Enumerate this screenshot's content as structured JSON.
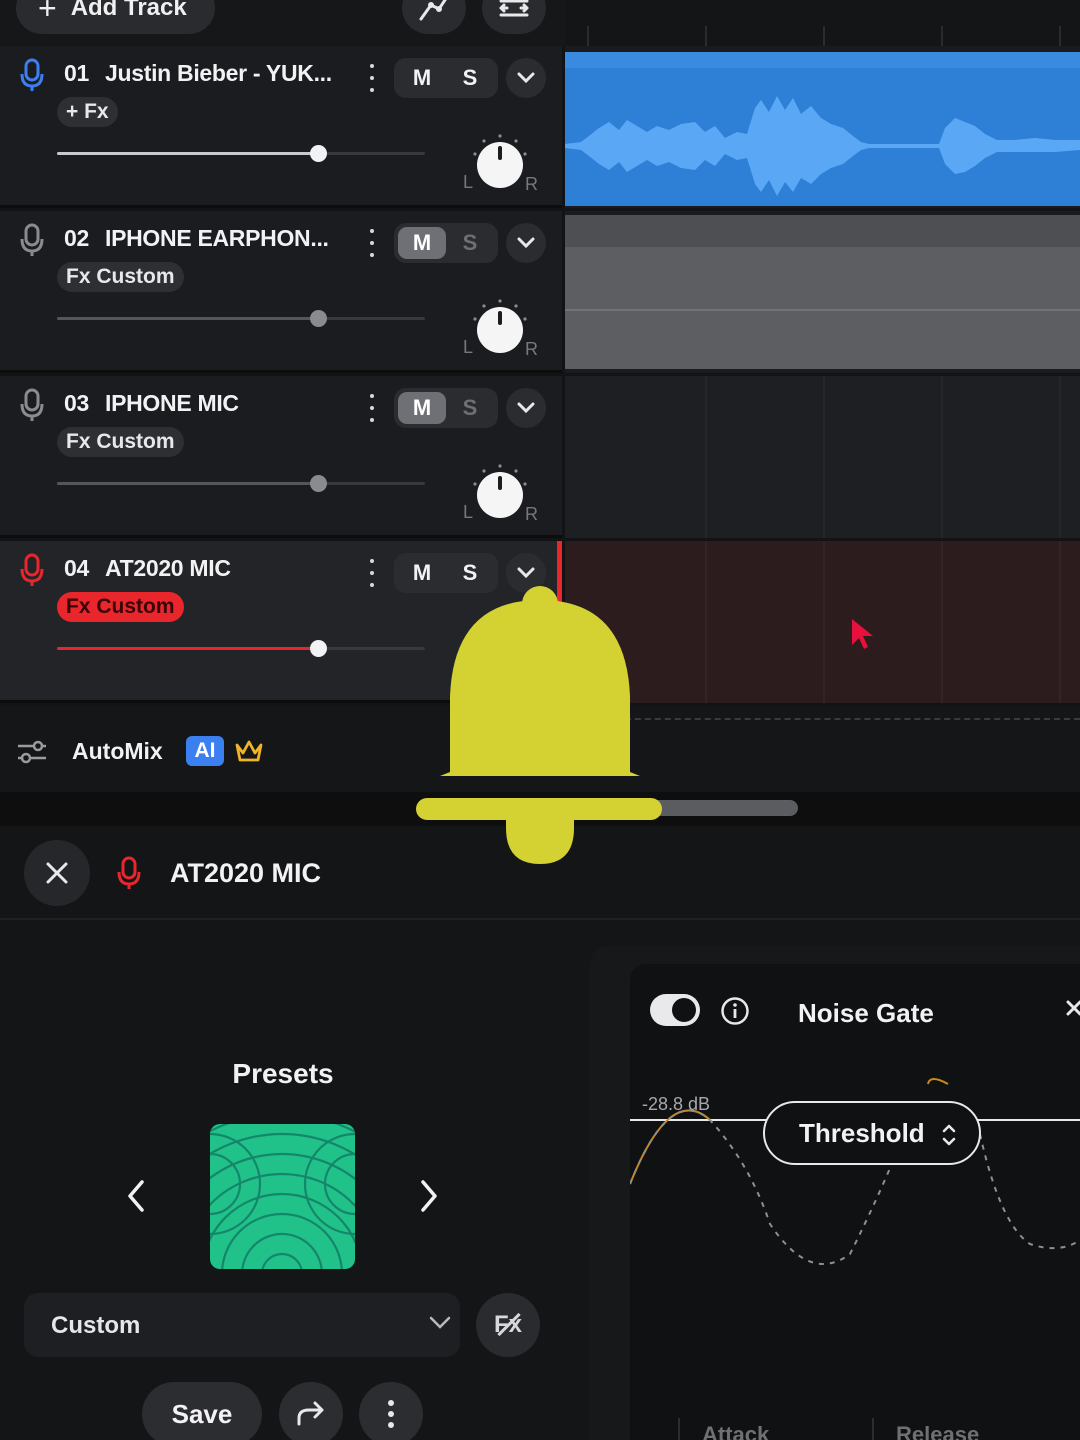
{
  "toolbar": {
    "add_track_label": "Add Track"
  },
  "tracks": [
    {
      "number": "01",
      "name": "Justin Bieber - YUK...",
      "fx_label": "+ Fx",
      "mute_label": "M",
      "solo_label": "S",
      "mic_color": "#3b7ff0",
      "muted": false,
      "volume": 0.71,
      "pan": "center"
    },
    {
      "number": "02",
      "name": "IPHONE EARPHON...",
      "fx_label": "Fx Custom",
      "mute_label": "M",
      "solo_label": "S",
      "mic_color": "#8a8b8f",
      "muted": true,
      "volume": 0.71,
      "pan": "center"
    },
    {
      "number": "03",
      "name": "IPHONE MIC",
      "fx_label": "Fx Custom",
      "mute_label": "M",
      "solo_label": "S",
      "mic_color": "#8a8b8f",
      "muted": true,
      "volume": 0.71,
      "pan": "center"
    },
    {
      "number": "04",
      "name": "AT2020 MIC",
      "fx_label": "Fx Custom",
      "mute_label": "M",
      "solo_label": "S",
      "mic_color": "#e8262c",
      "muted": false,
      "volume": 0.71,
      "pan": "center",
      "selected": true
    }
  ],
  "automix": {
    "label": "AutoMix",
    "badge": "AI"
  },
  "panel": {
    "track_name": "AT2020 MIC",
    "presets_title": "Presets",
    "preset_value": "Custom",
    "save_label": "Save"
  },
  "effect": {
    "name": "Noise Gate",
    "enabled": true,
    "threshold_value": "-28.8 dB",
    "control_label": "Threshold",
    "params": [
      "Attack",
      "Release"
    ]
  },
  "colors": {
    "accent_red": "#e8262c",
    "clip_blue": "#2e7fd6",
    "preset_green": "#20c28a",
    "bell_yellow": "#d4d133"
  },
  "icons": {
    "bell_overlay": "bell-icon"
  }
}
